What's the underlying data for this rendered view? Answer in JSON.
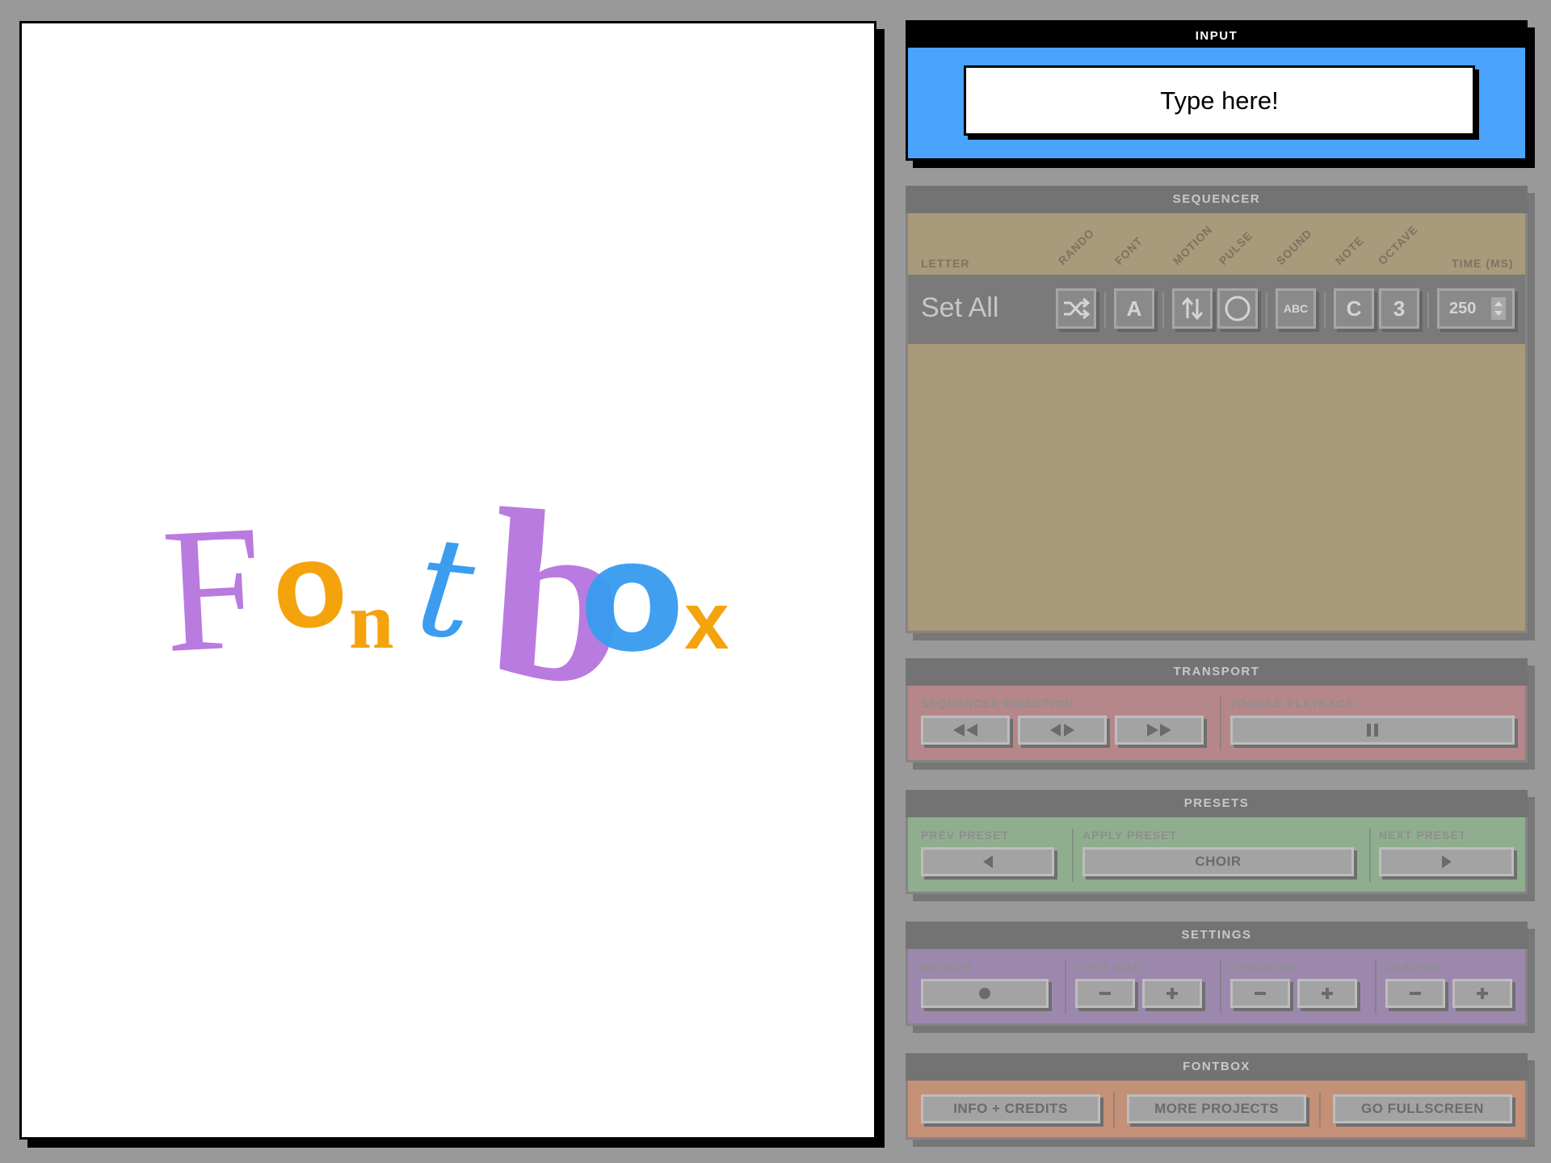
{
  "canvas": {
    "letters": [
      "F",
      "o",
      "n",
      "t",
      "b",
      "o",
      "x"
    ]
  },
  "input": {
    "header": "INPUT",
    "placeholder": "Type here!"
  },
  "sequencer": {
    "header": "SEQUENCER",
    "columns": {
      "letter": "LETTER",
      "rando": "RANDO",
      "font": "FONT",
      "motion": "MOTION",
      "pulse": "PULSE",
      "sound": "SOUND",
      "note": "NOTE",
      "octave": "OCTAVE",
      "time": "TIME (MS)"
    },
    "set_all": {
      "label": "Set All",
      "font_value": "A",
      "sound_value": "ABC",
      "note_value": "C",
      "octave_value": "3",
      "time_value": "250"
    }
  },
  "transport": {
    "header": "TRANSPORT",
    "direction_label": "SEQUENCER DIRECTION",
    "playback_label": "TOGGLE PLAYBACK"
  },
  "presets": {
    "header": "PRESETS",
    "prev_label": "PREV PRESET",
    "apply_label": "APPLY PRESET",
    "apply_value": "CHOIR",
    "next_label": "NEXT PRESET"
  },
  "settings": {
    "header": "SETTINGS",
    "motion_label": "MOTION",
    "font_size_label": "FONT SIZE",
    "tracking_label": "TRACKING",
    "leading_label": "LEADING"
  },
  "fontbox": {
    "header": "FONTBOX",
    "info_button": "INFO + CREDITS",
    "more_button": "MORE PROJECTS",
    "fullscreen_button": "GO FULLSCREEN"
  },
  "colors": {
    "input": "#4aa3fc",
    "sequencer": "#a89a7a",
    "transport": "#b5878a",
    "presets": "#8fae8e",
    "settings": "#9c88ac",
    "fontbox": "#c49078",
    "purple_letter": "#b97be0",
    "orange_letter": "#f5a30c",
    "blue_letter": "#3b9cf0"
  },
  "icons": {
    "rando": "shuffle-icon",
    "motion": "up-down-arrows-icon",
    "pulse": "circle-icon",
    "rewind": "rewind-icon",
    "bounce": "bidirectional-icon",
    "forward": "fast-forward-icon",
    "pause": "pause-icon",
    "prev": "triangle-left-icon",
    "next": "triangle-right-icon",
    "motion_toggle": "dot-icon",
    "minus": "minus-icon",
    "plus": "plus-icon"
  }
}
